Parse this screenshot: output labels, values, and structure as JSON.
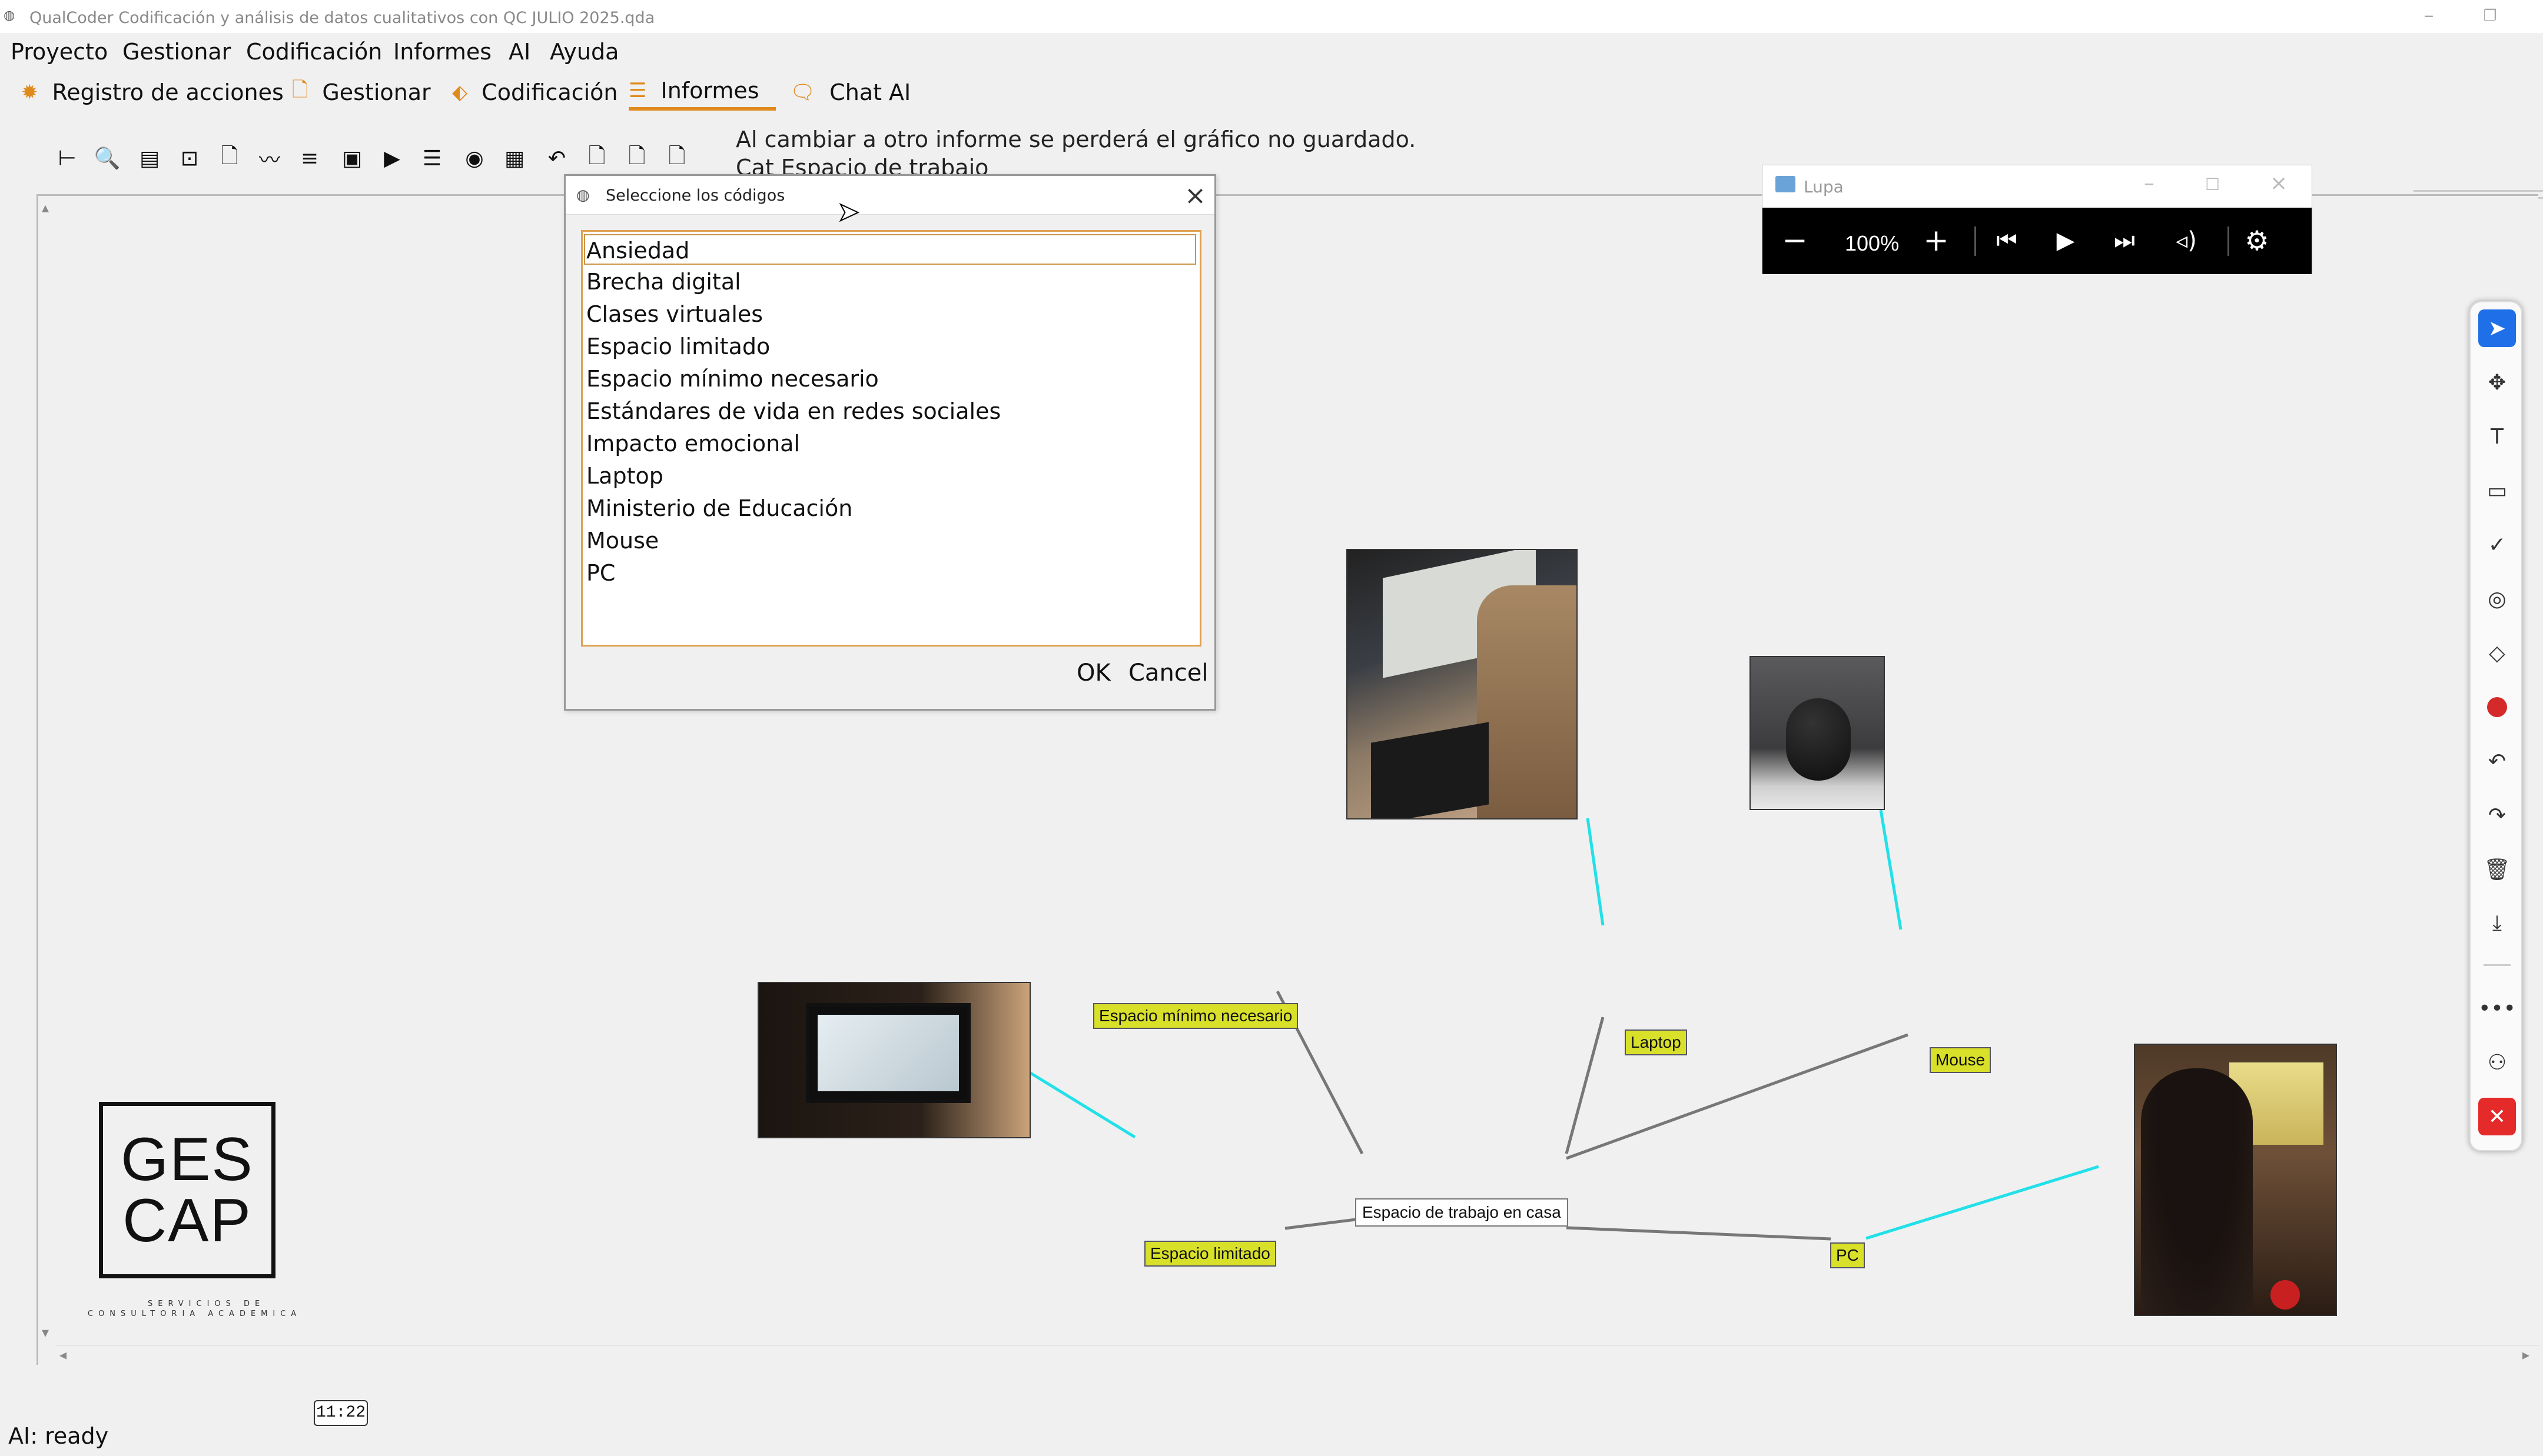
{
  "window": {
    "title": "QualCoder Codificación y análisis de datos cualitativos con QC JULIO 2025.qda",
    "app_icon": "qualcoder-icon"
  },
  "menu": [
    "Proyecto",
    "Gestionar",
    "Codificación",
    "Informes",
    "AI",
    "Ayuda"
  ],
  "tabs": [
    {
      "label": "Registro de acciones",
      "icon": "gear-icon",
      "active": false
    },
    {
      "label": "Gestionar",
      "icon": "document-icon",
      "active": false
    },
    {
      "label": "Codificación",
      "icon": "tag-icon",
      "active": false
    },
    {
      "label": "Informes",
      "icon": "report-icon",
      "active": true
    },
    {
      "label": "Chat AI",
      "icon": "chat-icon",
      "active": false
    }
  ],
  "notice": {
    "line1": "Al cambiar a otro informe se perderá el gráfico no guardado.",
    "line2": "Cat Espacio de trabajo"
  },
  "dialog": {
    "title": "Seleccione los códigos",
    "codes": [
      "Ansiedad",
      "Brecha digital",
      "Clases virtuales",
      "Espacio limitado",
      "Espacio mínimo necesario",
      "Estándares de vida en redes sociales",
      "Impacto emocional",
      "Laptop",
      "Ministerio de Educación",
      "Mouse",
      "PC"
    ],
    "selected": "Ansiedad",
    "ok_label": "OK",
    "cancel_label": "Cancel"
  },
  "graph": {
    "center": "Espacio de trabajo en casa",
    "nodes": {
      "espacio_minimo": "Espacio mínimo necesario",
      "laptop": "Laptop",
      "mouse": "Mouse",
      "espacio_limitado": "Espacio limitado",
      "pc": "PC"
    },
    "node_color": "#d8e02a",
    "image_link_color": "#22e0e8",
    "code_link_color": "#777777"
  },
  "logo": {
    "line1": "GES",
    "line2": "CAP",
    "sub1": "SERVICIOS DE",
    "sub2": "CONSULTORIA ACADEMICA"
  },
  "lupa": {
    "title": "Lupa",
    "zoom": "100%"
  },
  "status": {
    "text": "AI: ready",
    "time": "11:22"
  },
  "accent_color": "#e08a1e"
}
